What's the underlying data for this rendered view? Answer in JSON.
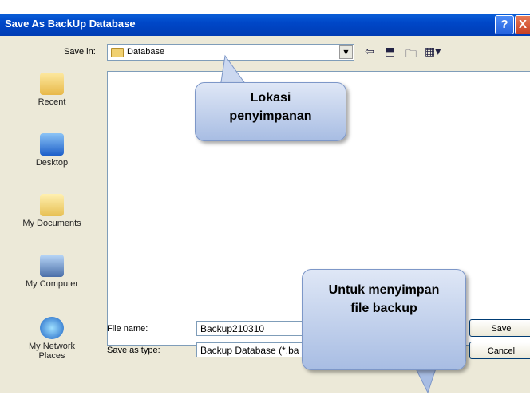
{
  "window": {
    "title": "Save As BackUp Database",
    "help": "?",
    "close": "X"
  },
  "save_in": {
    "label": "Save in:",
    "value": "Database"
  },
  "places": [
    {
      "label": "Recent"
    },
    {
      "label": "Desktop"
    },
    {
      "label": "My Documents"
    },
    {
      "label": "My Computer"
    },
    {
      "label": "My Network Places"
    }
  ],
  "file_name": {
    "label": "File name:",
    "value": "Backup210310"
  },
  "save_type": {
    "label": "Save as type:",
    "value": "Backup Database (*.ba"
  },
  "buttons": {
    "save": "Save",
    "cancel": "Cancel"
  },
  "callouts": {
    "location": "Lokasi penyimpanan",
    "backup": "Untuk menyimpan file backup"
  }
}
